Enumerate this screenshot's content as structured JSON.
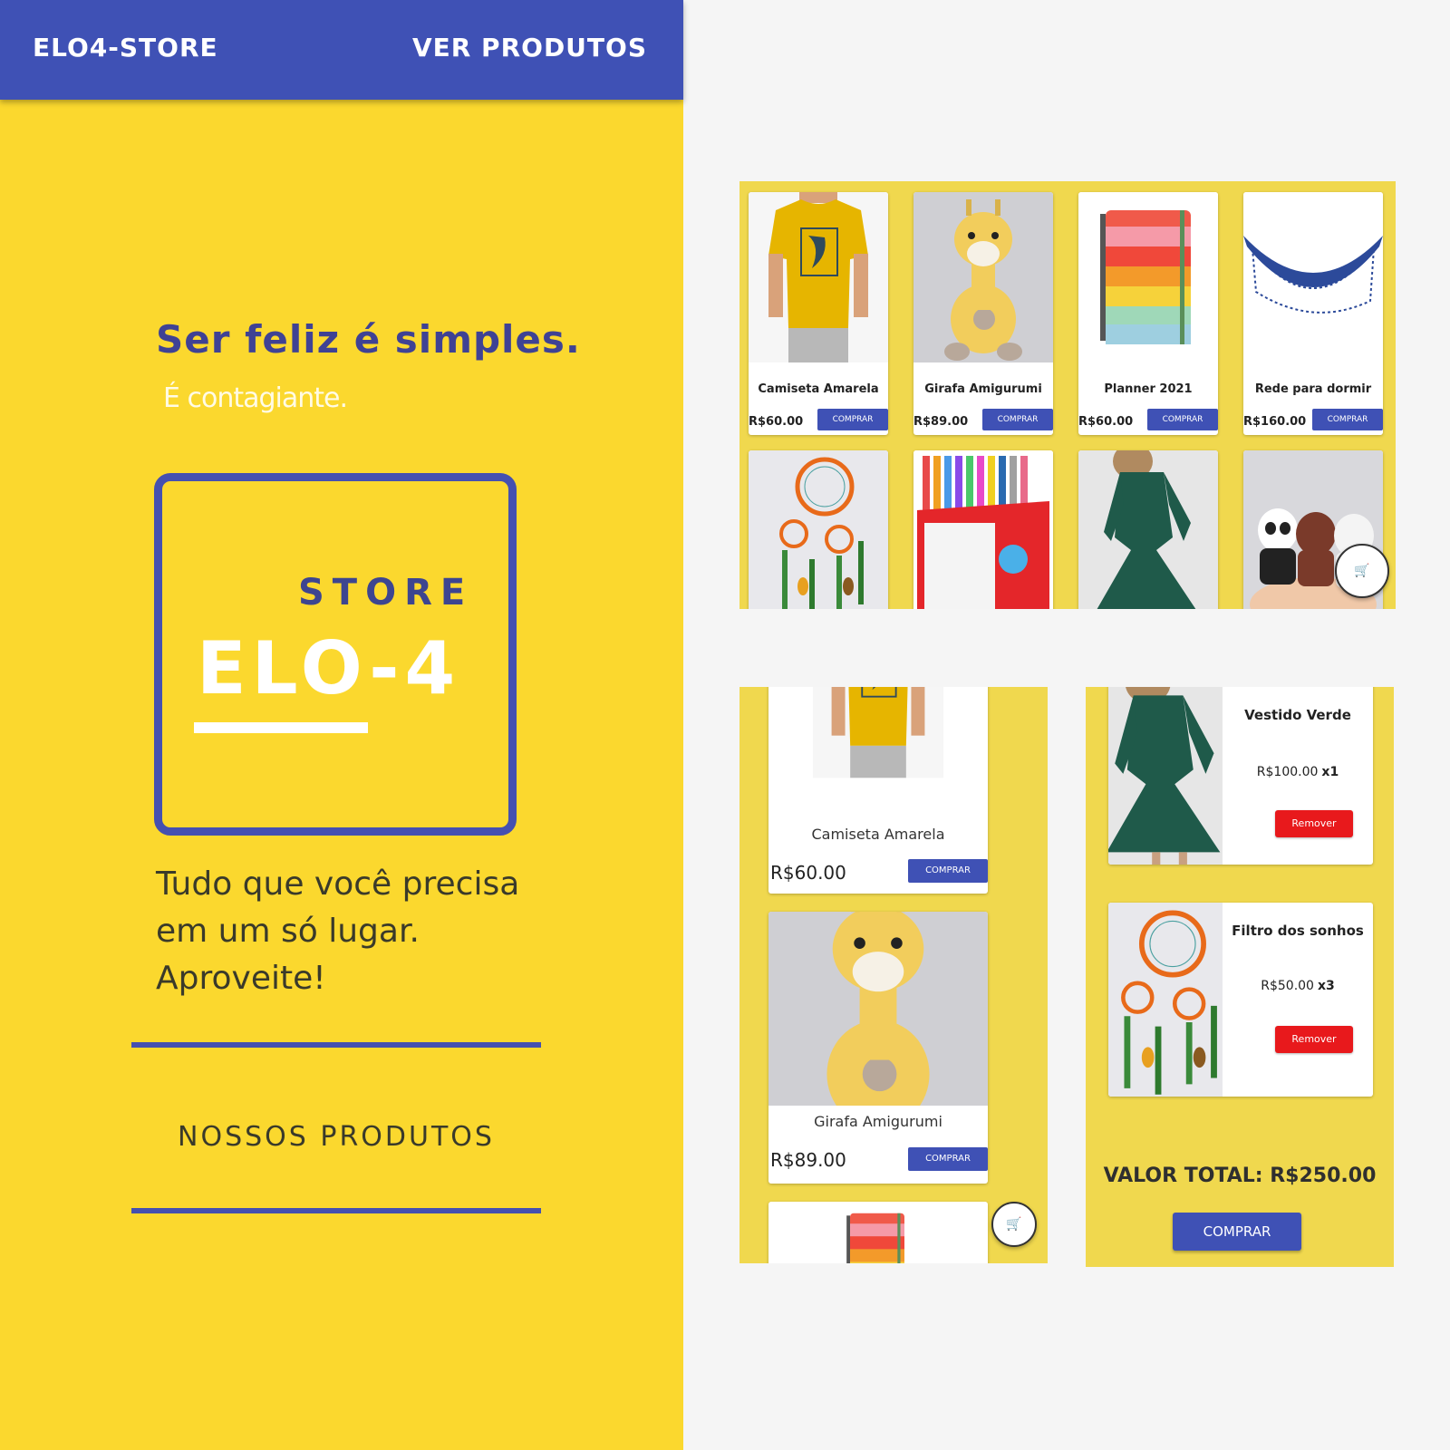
{
  "header": {
    "brand": "ELO4-STORE",
    "nav_link": "VER PRODUTOS"
  },
  "hero": {
    "title": "Ser feliz é simples.",
    "subtitle": "É contagiante.",
    "logo_store": "STORE",
    "logo_name": "ELO-4",
    "tagline": [
      "Tudo que você precisa",
      "em um só lugar.",
      "Aproveite!"
    ],
    "section_title": "NOSSOS PRODUTOS"
  },
  "grid": {
    "buy_label": "COMPRAR",
    "products": [
      {
        "name": "Camiseta Amarela",
        "price": "R$60.00",
        "image": "yellow-tshirt"
      },
      {
        "name": "Girafa Amigurumi",
        "price": "R$89.00",
        "image": "giraffe-plush"
      },
      {
        "name": "Planner 2021",
        "price": "R$60.00",
        "image": "planner"
      },
      {
        "name": "Rede para dormir",
        "price": "R$160.00",
        "image": "hammock"
      },
      {
        "image": "dreamcatcher"
      },
      {
        "image": "markers"
      },
      {
        "image": "green-dress"
      },
      {
        "image": "bear-plushies"
      }
    ],
    "cart_fab_icon": "cart-icon"
  },
  "mobile_list": {
    "buy_label": "COMPRAR",
    "products": [
      {
        "name": "Camiseta Amarela",
        "price": "R$60.00"
      },
      {
        "name": "Girafa Amigurumi",
        "price": "R$89.00"
      }
    ],
    "cart_fab_icon": "cart-icon"
  },
  "cart": {
    "items": [
      {
        "name": "Vestido Verde",
        "price": "R$100.00",
        "qty": "x1",
        "remove_label": "Remover",
        "image": "green-dress"
      },
      {
        "name": "Filtro dos sonhos",
        "price": "R$50.00",
        "qty": "x3",
        "remove_label": "Remover",
        "image": "dreamcatcher"
      }
    ],
    "total": "VALOR TOTAL: R$250.00",
    "buy_label": "COMPRAR"
  },
  "colors": {
    "primary": "#3f51b5",
    "landing_bg": "#fbd82e",
    "panel_bg": "#f0d84e",
    "danger": "#e8191c"
  }
}
